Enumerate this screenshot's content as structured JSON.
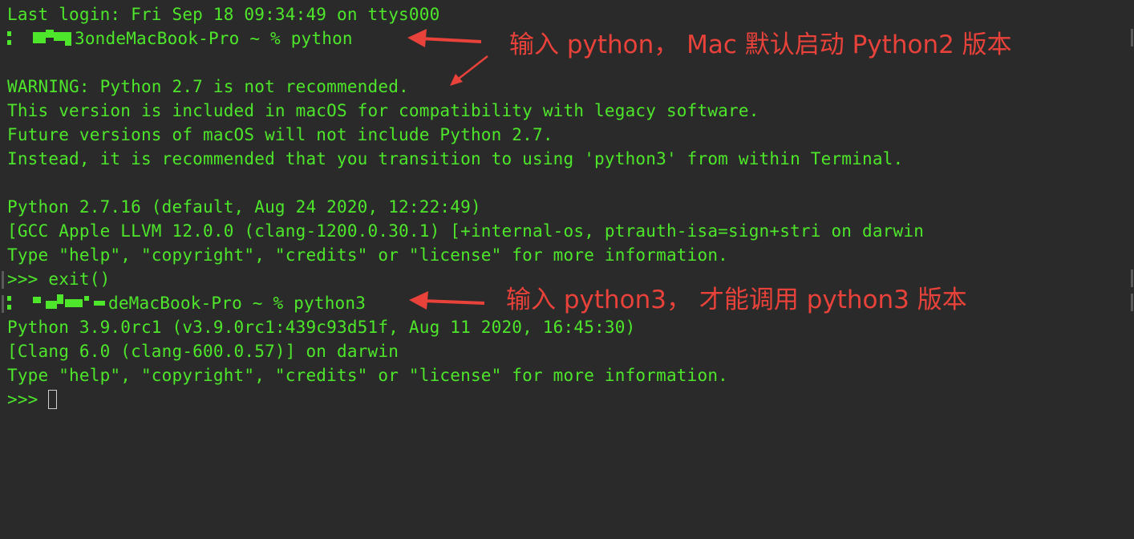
{
  "terminal": {
    "lines": [
      "Last login: Fri Sep 18 09:34:49 on ttys000",
      "3ondeMacBook-Pro ~ % python",
      "",
      "WARNING: Python 2.7 is not recommended.",
      "This version is included in macOS for compatibility with legacy software.",
      "Future versions of macOS will not include Python 2.7.",
      "Instead, it is recommended that you transition to using 'python3' from within Terminal.",
      "",
      "Python 2.7.16 (default, Aug 24 2020, 12:22:49)",
      "[GCC Apple LLVM 12.0.0 (clang-1200.0.30.1) [+internal-os, ptrauth-isa=sign+stri on darwin",
      "Type \"help\", \"copyright\", \"credits\" or \"license\" for more information.",
      ">>> exit()",
      "deMacBook-Pro ~ % python3",
      "Python 3.9.0rc1 (v3.9.0rc1:439c93d51f, Aug 11 2020, 16:45:30)",
      "[Clang 6.0 (clang-600.0.57)] on darwin",
      "Type \"help\", \"copyright\", \"credits\" or \"license\" for more information.",
      ">>> "
    ]
  },
  "annotations": {
    "python2": "输入 python， Mac 默认启动 Python2 版本",
    "python3": "输入 python3， 才能调用 python3 版本"
  },
  "colors": {
    "background": "#2a2a2a",
    "terminal_text": "#4ee62b",
    "annotation": "#e8423a"
  }
}
